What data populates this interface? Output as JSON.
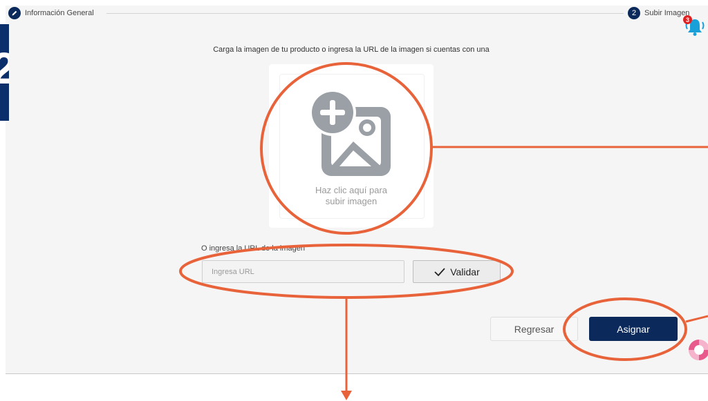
{
  "stepper": {
    "step1": {
      "icon": "pencil-icon",
      "label": "Información General"
    },
    "step2": {
      "number": "2",
      "label": "Subir Imagen"
    }
  },
  "notifications": {
    "icon": "bell-icon",
    "count": "3"
  },
  "instruction": "Carga la imagen de tu producto o ingresa la URL de la imagen si cuentas con una",
  "upload": {
    "icon": "add-image-icon",
    "line1": "Haz clic aquí para",
    "line2": "subir imagen"
  },
  "url": {
    "label": "O ingresa la URL de la imagen",
    "placeholder": "Ingresa URL",
    "validate_label": "Validar",
    "validate_icon": "check-icon"
  },
  "actions": {
    "back_label": "Regresar",
    "assign_label": "Asignar"
  },
  "side_tab": {
    "glyph": "2"
  },
  "help": {
    "icon": "lifebuoy-icon"
  },
  "colors": {
    "primary": "#0b2a5b",
    "annotation": "#e8623a",
    "badge": "#e02020",
    "bell": "#1aa0d8"
  }
}
